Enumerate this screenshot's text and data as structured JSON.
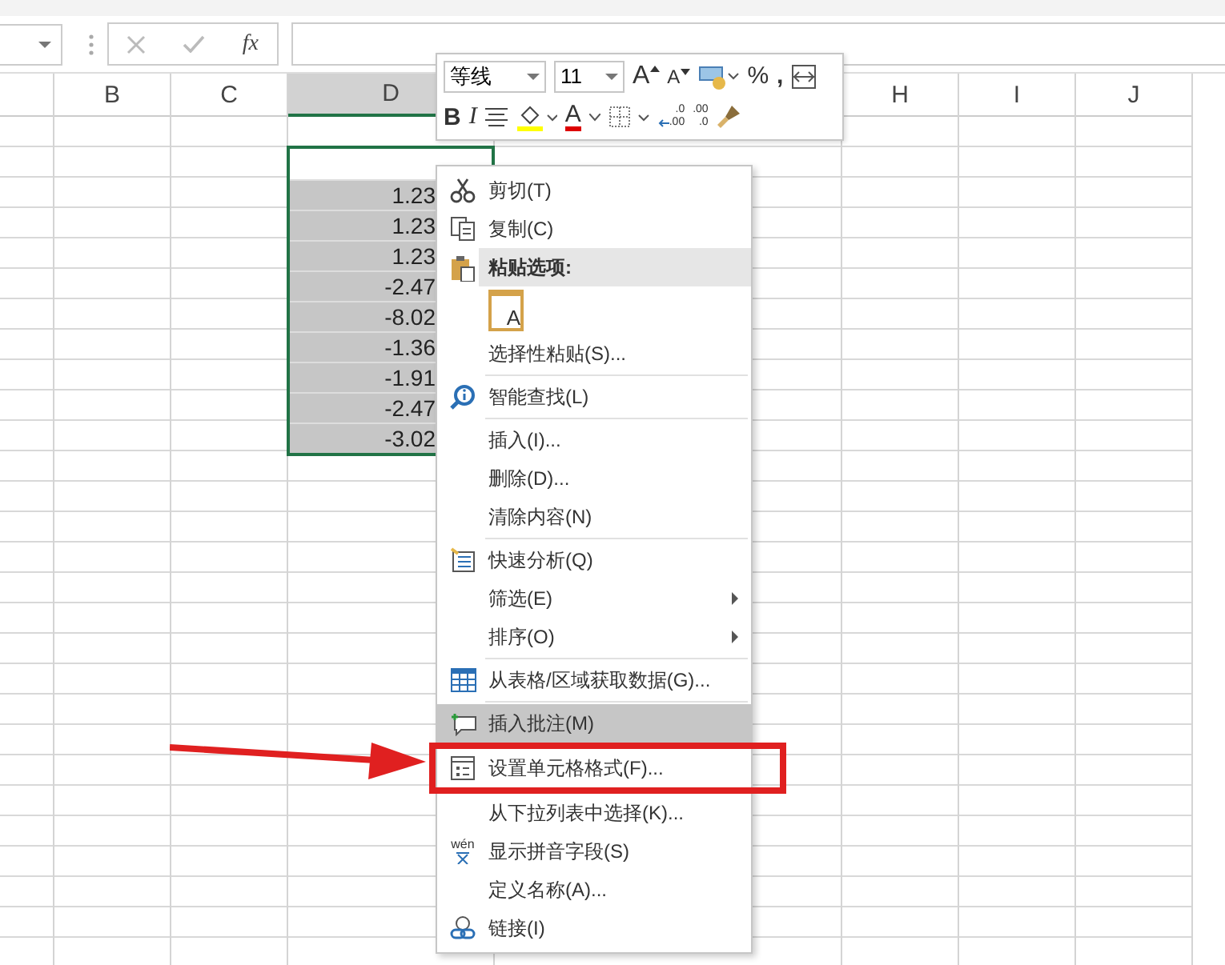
{
  "formula_bar": {
    "function_label": "fx"
  },
  "columns": [
    {
      "label": "B",
      "selected": false
    },
    {
      "label": "C",
      "selected": false
    },
    {
      "label": "D",
      "selected": true
    },
    {
      "label": "H",
      "selected": false
    },
    {
      "label": "I",
      "selected": false
    },
    {
      "label": "J",
      "selected": false
    }
  ],
  "cells": [
    "1.23",
    "1.23",
    "1.23",
    "-2.47",
    "-8.02",
    "-1.36",
    "-1.91",
    "-2.47",
    "-3.02"
  ],
  "mini_toolbar": {
    "font": "等线",
    "size": "11",
    "grow_font": "A",
    "shrink_font": "A",
    "percent": "%",
    "comma": ",",
    "bold": "B",
    "italic": "I",
    "font_color_letter": "A",
    "add_decimal": [
      ".0",
      ".00"
    ],
    "remove_decimal": [
      ".00",
      ".0"
    ]
  },
  "context_menu": [
    {
      "kind": "item",
      "label": "剪切(T)",
      "submenu": false,
      "selected": false,
      "highlighted": false
    },
    {
      "kind": "item",
      "label": "复制(C)",
      "submenu": false,
      "selected": false,
      "highlighted": false
    },
    {
      "kind": "header",
      "label": "粘贴选项:"
    },
    {
      "kind": "paste-icons",
      "label": "A"
    },
    {
      "kind": "item",
      "label": "选择性粘贴(S)...",
      "submenu": false,
      "selected": false,
      "highlighted": false
    },
    {
      "kind": "separator"
    },
    {
      "kind": "item",
      "label": "智能查找(L)",
      "submenu": false,
      "selected": false,
      "highlighted": false
    },
    {
      "kind": "separator"
    },
    {
      "kind": "item",
      "label": "插入(I)...",
      "submenu": false,
      "selected": false,
      "highlighted": false
    },
    {
      "kind": "item",
      "label": "删除(D)...",
      "submenu": false,
      "selected": false,
      "highlighted": false
    },
    {
      "kind": "item",
      "label": "清除内容(N)",
      "submenu": false,
      "selected": false,
      "highlighted": false
    },
    {
      "kind": "separator"
    },
    {
      "kind": "item",
      "label": "快速分析(Q)",
      "submenu": false,
      "selected": false,
      "highlighted": false
    },
    {
      "kind": "item",
      "label": "筛选(E)",
      "submenu": true,
      "selected": false,
      "highlighted": false
    },
    {
      "kind": "item",
      "label": "排序(O)",
      "submenu": true,
      "selected": false,
      "highlighted": false
    },
    {
      "kind": "separator"
    },
    {
      "kind": "item",
      "label": "从表格/区域获取数据(G)...",
      "submenu": false,
      "selected": false,
      "highlighted": false
    },
    {
      "kind": "separator"
    },
    {
      "kind": "item",
      "label": "插入批注(M)",
      "submenu": false,
      "selected": true,
      "highlighted": false
    },
    {
      "kind": "item",
      "label": "设置单元格格式(F)...",
      "submenu": false,
      "selected": false,
      "highlighted": true
    },
    {
      "kind": "item",
      "label": "从下拉列表中选择(K)...",
      "submenu": false,
      "selected": false,
      "highlighted": false
    },
    {
      "kind": "item",
      "label": "显示拼音字段(S)",
      "icon_text": "wén",
      "submenu": false,
      "selected": false,
      "highlighted": false
    },
    {
      "kind": "item",
      "label": "定义名称(A)...",
      "submenu": false,
      "selected": false,
      "highlighted": false
    },
    {
      "kind": "item",
      "label": "链接(I)",
      "submenu": false,
      "selected": false,
      "highlighted": false
    }
  ]
}
